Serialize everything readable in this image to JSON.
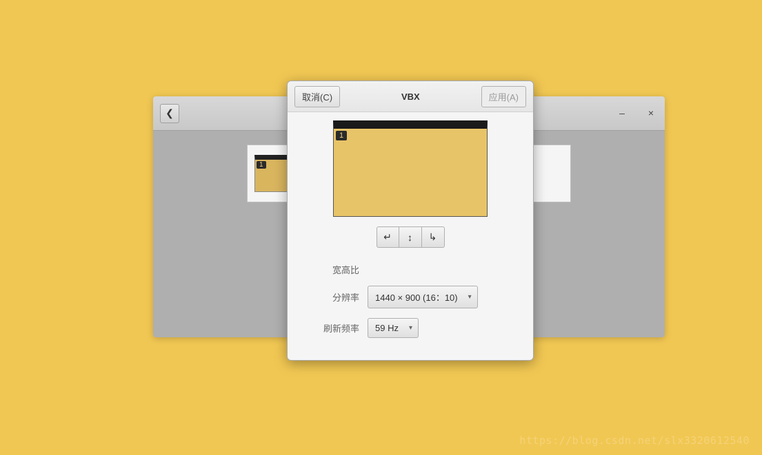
{
  "parent_window": {
    "mini_badge": "1"
  },
  "dialog": {
    "cancel_label": "取消(C)",
    "title": "VBX",
    "apply_label": "应用(A)",
    "preview_badge": "1",
    "rotate_left_glyph": "↵",
    "rotate_flip_glyph": "↕",
    "rotate_right_glyph": "↳",
    "aspect_label": "宽高比",
    "resolution_label": "分辨率",
    "resolution_value": "1440 × 900 (16：10)",
    "refresh_label": "刷新频率",
    "refresh_value": "59 Hz"
  },
  "watermark": "https://blog.csdn.net/slx3320612540"
}
